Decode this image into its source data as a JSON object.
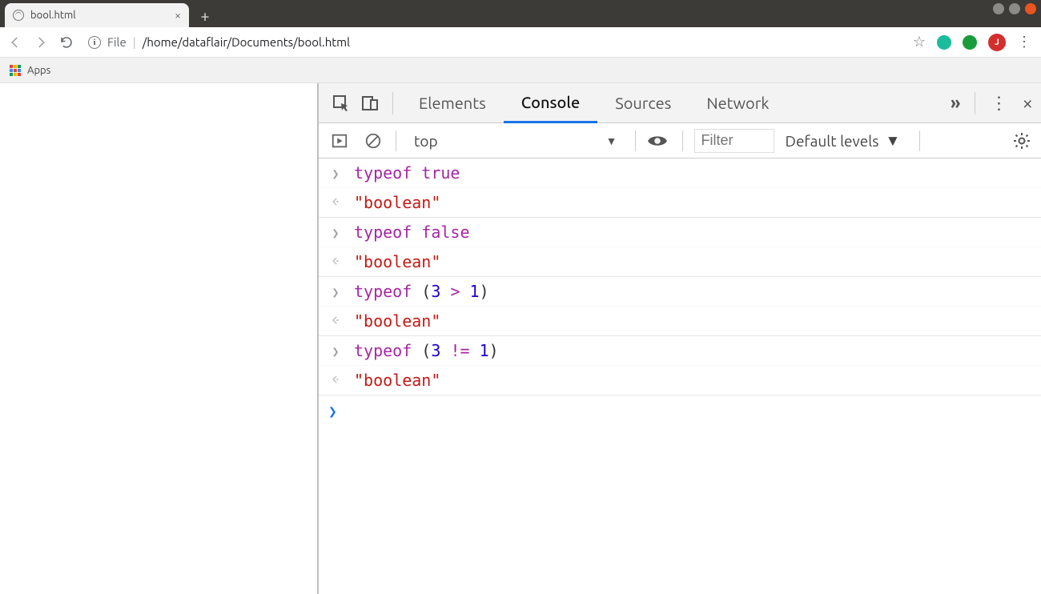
{
  "window": {
    "tab_title": "bool.html"
  },
  "toolbar": {
    "file_label": "File",
    "path": "/home/dataflair/Documents/bool.html",
    "avatar_initial": "J"
  },
  "bookmarks": {
    "apps_label": "Apps"
  },
  "devtools": {
    "tabs": {
      "elements": "Elements",
      "console": "Console",
      "sources": "Sources",
      "network": "Network"
    },
    "console_toolbar": {
      "context": "top",
      "filter_placeholder": "Filter",
      "levels_label": "Default levels"
    },
    "console": {
      "entries": [
        {
          "input_tokens": [
            {
              "t": "kw",
              "v": "typeof"
            },
            {
              "t": "sp",
              "v": " "
            },
            {
              "t": "bool",
              "v": "true"
            }
          ],
          "output": "\"boolean\""
        },
        {
          "input_tokens": [
            {
              "t": "kw",
              "v": "typeof"
            },
            {
              "t": "sp",
              "v": " "
            },
            {
              "t": "bool",
              "v": "false"
            }
          ],
          "output": "\"boolean\""
        },
        {
          "input_tokens": [
            {
              "t": "kw",
              "v": "typeof"
            },
            {
              "t": "sp",
              "v": " "
            },
            {
              "t": "punc",
              "v": "("
            },
            {
              "t": "num",
              "v": "3"
            },
            {
              "t": "sp",
              "v": " "
            },
            {
              "t": "op",
              "v": ">"
            },
            {
              "t": "sp",
              "v": " "
            },
            {
              "t": "num",
              "v": "1"
            },
            {
              "t": "punc",
              "v": ")"
            }
          ],
          "output": "\"boolean\""
        },
        {
          "input_tokens": [
            {
              "t": "kw",
              "v": "typeof"
            },
            {
              "t": "sp",
              "v": " "
            },
            {
              "t": "punc",
              "v": "("
            },
            {
              "t": "num",
              "v": "3"
            },
            {
              "t": "sp",
              "v": " "
            },
            {
              "t": "op",
              "v": "!="
            },
            {
              "t": "sp",
              "v": " "
            },
            {
              "t": "num",
              "v": "1"
            },
            {
              "t": "punc",
              "v": ")"
            }
          ],
          "output": "\"boolean\""
        }
      ]
    }
  }
}
